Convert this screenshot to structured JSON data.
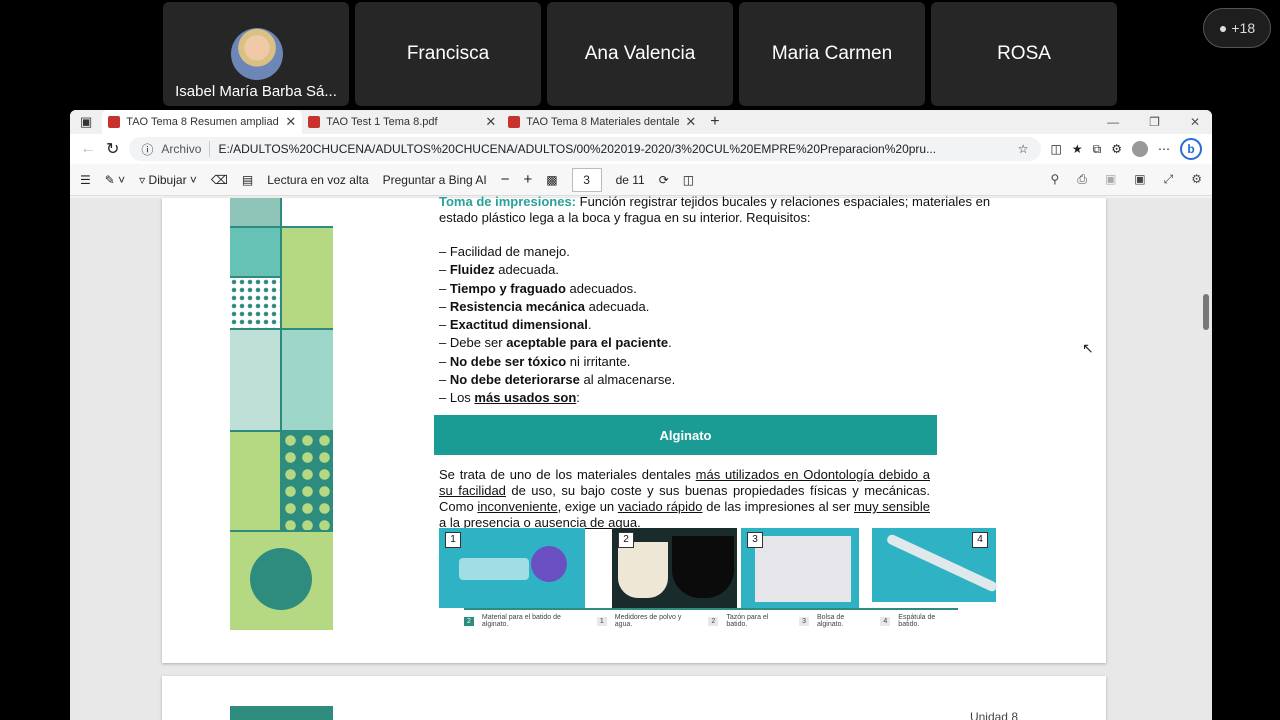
{
  "participants": [
    {
      "name": "Isabel María Barba Sá..."
    },
    {
      "name": "Francisca"
    },
    {
      "name": "Ana Valencia"
    },
    {
      "name": "Maria Carmen"
    },
    {
      "name": "ROSA"
    }
  ],
  "overflow_badge": "+18",
  "browser": {
    "tabs": [
      {
        "title": "TAO Tema 8 Resumen ampliado"
      },
      {
        "title": "TAO Test 1 Tema 8.pdf"
      },
      {
        "title": "TAO Tema 8 Materiales dentales"
      }
    ],
    "address_label": "Archivo",
    "url": "E:/ADULTOS%20CHUCENA/ADULTOS%20CHUCENA/ADULTOS/00%202019-2020/3%20CUL%20EMPRE%20Preparacion%20pru..."
  },
  "pdf_toolbar": {
    "draw_label": "Dibujar",
    "read_aloud_label": "Lectura en voz alta",
    "ask_bing_label": "Preguntar a Bing AI",
    "current_page": "3",
    "total_pages": "de 11"
  },
  "document": {
    "intro_heading": "Toma de impresiones:",
    "intro_text": " Función registrar tejidos bucales y relaciones espaciales; materiales en estado plástico lega a la boca y fragua en su interior. Requisitos:",
    "requirements": [
      {
        "pre": "– Facilidad de manejo.",
        "bold": "",
        "post": ""
      },
      {
        "pre": "– ",
        "bold": "Fluidez",
        "post": " adecuada."
      },
      {
        "pre": "– ",
        "bold": "Tiempo y fraguado",
        "post": " adecuados."
      },
      {
        "pre": "– ",
        "bold": "Resistencia mecánica",
        "post": " adecuada."
      },
      {
        "pre": "– ",
        "bold": "Exactitud dimensional",
        "post": "."
      },
      {
        "pre": "– Debe ser ",
        "bold": "aceptable para el paciente",
        "post": "."
      },
      {
        "pre": "– ",
        "bold": "No debe ser tóxico",
        "post": " ni irritante."
      },
      {
        "pre": "– ",
        "bold": "No debe deteriorarse",
        "post": " al almacenarse."
      },
      {
        "pre": "– Los ",
        "bold": "más usados son",
        "post": ":"
      }
    ],
    "banner": "Alginato",
    "paragraph": [
      {
        "t": "Se trata de uno de los materiales dentales ",
        "u": false
      },
      {
        "t": "más utilizados en Odontología debido a su facilidad",
        "u": true
      },
      {
        "t": " de uso, su bajo coste y sus buenas propiedades físicas y mecánicas. Como ",
        "u": false
      },
      {
        "t": "inconveniente",
        "u": true
      },
      {
        "t": ", exige un ",
        "u": false
      },
      {
        "t": "vaciado rápido",
        "u": true
      },
      {
        "t": " de las impresiones al ser ",
        "u": false
      },
      {
        "t": "muy sensible",
        "u": true
      },
      {
        "t": " a la presencia o ",
        "u": false
      },
      {
        "t": "ausencia de agua",
        "u": true
      },
      {
        "t": ".",
        "u": false
      }
    ],
    "photos": [
      {
        "num": "1",
        "color": "#2fb3c4"
      },
      {
        "num": "2",
        "color": "#1a2b2b"
      },
      {
        "num": "3",
        "color": "#2fb3c4"
      },
      {
        "num": "4",
        "color": "#2fb3c4"
      }
    ],
    "caption": {
      "n0": "2",
      "t0": "Material para el batido de alginato.",
      "n1": "1",
      "t1": "Medidores de polvo y agua.",
      "n2": "2",
      "t2": "Tazón para el batido.",
      "n3": "3",
      "t3": "Bolsa de alginato.",
      "n4": "4",
      "t4": "Espátula de batido."
    },
    "next_page_header": "Unidad 8"
  }
}
